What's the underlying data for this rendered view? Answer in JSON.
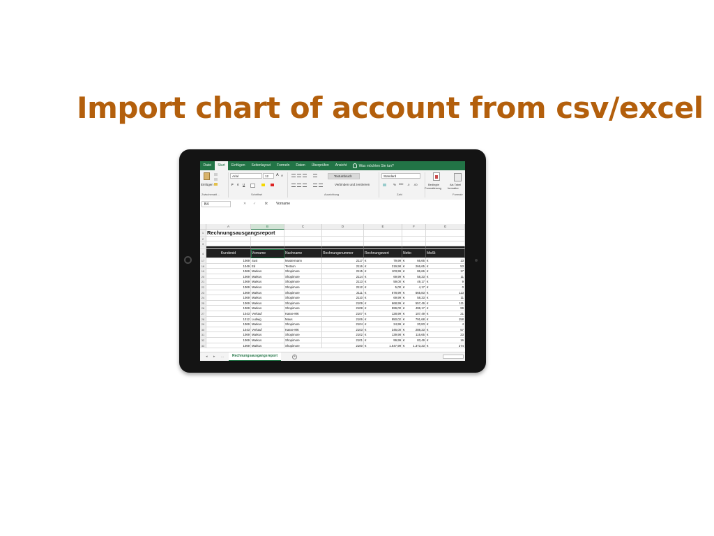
{
  "slide": {
    "title": "Import chart of account from csv/excel"
  },
  "excel": {
    "tabs": [
      "Datei",
      "Start",
      "Einfügen",
      "Seitenlayout",
      "Formeln",
      "Daten",
      "Überprüfen",
      "Ansicht"
    ],
    "active_tab": "Start",
    "tell_me": "Was möchten Sie tun?",
    "ribbon": {
      "paste_label": "Einfügen",
      "font_name": "Arial",
      "font_size": "12",
      "grow_font": "A",
      "shrink_font": "A",
      "bold": "F",
      "italic": "K",
      "underline": "U",
      "wrap_text": "Textumbruch",
      "merge_center": "Verbinden und zentrieren",
      "number_format": "Standard",
      "percent": "%",
      "thousands": "000",
      "cond_format": "Bedingte",
      "cond_format2": "Formatierung",
      "as_table": "Als Tabel",
      "as_table2": "formatier",
      "groups": [
        "Zwischenabl…",
        "Schriftart",
        "Ausrichtung",
        "Zahl",
        "Formatv"
      ]
    },
    "formula_bar": {
      "name_box": "B4",
      "cancel": "✕",
      "confirm": "✓",
      "fx": "fx",
      "value": "Vorname"
    },
    "column_letters": [
      "A",
      "B",
      "C",
      "D",
      "E",
      "F",
      "G"
    ],
    "report_title": "Rechnungsausgangsreport",
    "headers": [
      "Kundenid",
      "Vorname",
      "Nachname",
      "Rechnungsnummer",
      "Rechnungswert",
      "Netto",
      "MwSt"
    ],
    "currency": "€",
    "header_row_number": "4",
    "top_rows": [
      "1",
      "2",
      "3"
    ],
    "rows": [
      {
        "num": "17",
        "id": "1069",
        "first": "Susi",
        "last": "Mustermann",
        "inv": "2117",
        "value": "79,99",
        "net": "66,66",
        "vat": "13"
      },
      {
        "num": "18",
        "id": "1049",
        "first": "Ed",
        "last": "Testson",
        "inv": "2116",
        "value": "319,98",
        "net": "266,65",
        "vat": "53"
      },
      {
        "num": "19",
        "id": "1069",
        "first": "Markus",
        "last": "Shopimore",
        "inv": "2115",
        "value": "103,99",
        "net": "86,66",
        "vat": "17"
      },
      {
        "num": "20",
        "id": "1069",
        "first": "Markus",
        "last": "Shopimore",
        "inv": "2114",
        "value": "69,99",
        "net": "58,33",
        "vat": "11"
      },
      {
        "num": "21",
        "id": "1069",
        "first": "Markus",
        "last": "Shopimore",
        "inv": "2113",
        "value": "59,00",
        "net": "49,17",
        "vat": "9"
      },
      {
        "num": "22",
        "id": "1069",
        "first": "Markus",
        "last": "Shopimore",
        "inv": "2112",
        "value": "5,00",
        "net": "4,17",
        "vat": "0"
      },
      {
        "num": "23",
        "id": "1069",
        "first": "Markus",
        "last": "Shopimore",
        "inv": "2111",
        "value": "678,99",
        "net": "565,83",
        "vat": "113"
      },
      {
        "num": "24",
        "id": "1069",
        "first": "Markus",
        "last": "Shopimore",
        "inv": "2110",
        "value": "69,99",
        "net": "58,33",
        "vat": "11"
      },
      {
        "num": "25",
        "id": "1069",
        "first": "Markus",
        "last": "Shopimore",
        "inv": "2109",
        "value": "668,99",
        "net": "557,49",
        "vat": "111"
      },
      {
        "num": "26",
        "id": "1069",
        "first": "Markus",
        "last": "Shopimore",
        "inv": "2108",
        "value": "599,00",
        "net": "499,17",
        "vat": "99"
      },
      {
        "num": "27",
        "id": "1043",
        "first": "Verkauf",
        "last": "Kasse-MK",
        "inv": "2107",
        "value": "128,99",
        "net": "107,49",
        "vat": "21"
      },
      {
        "num": "28",
        "id": "1012",
        "first": "Ludwig",
        "last": "Maus",
        "inv": "2106",
        "value": "950,02",
        "net": "791,68",
        "vat": "158"
      },
      {
        "num": "29",
        "id": "1069",
        "first": "Markus",
        "last": "Shopimore",
        "inv": "2104",
        "value": "24,99",
        "net": "20,83",
        "vat": "4"
      },
      {
        "num": "30",
        "id": "1043",
        "first": "Verkauf",
        "last": "Kasse-MK",
        "inv": "2103",
        "value": "346,00",
        "net": "288,33",
        "vat": "57"
      },
      {
        "num": "31",
        "id": "1069",
        "first": "Markus",
        "last": "Shopimore",
        "inv": "2102",
        "value": "139,98",
        "net": "116,65",
        "vat": "23"
      },
      {
        "num": "32",
        "id": "1069",
        "first": "Markus",
        "last": "Shopimore",
        "inv": "2101",
        "value": "99,99",
        "net": "83,49",
        "vat": "16"
      },
      {
        "num": "33",
        "id": "1069",
        "first": "Markus",
        "last": "Shopimore",
        "inv": "2100",
        "value": "1.647,99",
        "net": "1.373,33",
        "vat": "274"
      }
    ],
    "sheet_tab": "Rechnungsausgangsreport",
    "tab_nav": {
      "prev": "◂",
      "next": "▸",
      "more": "..."
    },
    "add_sheet": "+"
  }
}
